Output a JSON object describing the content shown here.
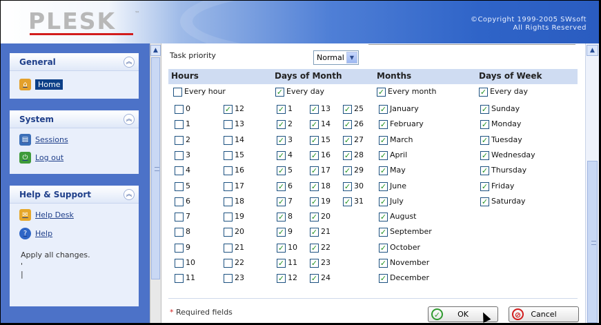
{
  "header": {
    "logo": "PLESK",
    "logo_tm": "™",
    "copyright_line1": "©Copyright 1999-2005 SWsoft",
    "copyright_line2": "All Rights Reserved"
  },
  "nav": {
    "general": {
      "title": "General",
      "items": [
        {
          "label": "Home"
        }
      ]
    },
    "system": {
      "title": "System",
      "items": [
        {
          "label": "Sessions"
        },
        {
          "label": "Log out"
        }
      ]
    },
    "help": {
      "title": "Help & Support",
      "items": [
        {
          "label": "Help Desk"
        },
        {
          "label": "Help"
        }
      ]
    },
    "status": "Apply all changes.",
    "status_marks": [
      "'",
      "|"
    ]
  },
  "form": {
    "task_priority_label": "Task priority",
    "task_priority_value": "Normal",
    "columns": {
      "hours": "Hours",
      "dom": "Days of Month",
      "months": "Months",
      "dow": "Days of Week"
    },
    "every": {
      "hour": "Every hour",
      "day": "Every day",
      "month": "Every month",
      "dow_day": "Every day"
    },
    "every_checked": {
      "hour": false,
      "day": true,
      "month": true,
      "dow_day": true
    },
    "hours": [
      {
        "label": "0",
        "checked": false
      },
      {
        "label": "1",
        "checked": false
      },
      {
        "label": "2",
        "checked": false
      },
      {
        "label": "3",
        "checked": false
      },
      {
        "label": "4",
        "checked": false
      },
      {
        "label": "5",
        "checked": false
      },
      {
        "label": "6",
        "checked": false
      },
      {
        "label": "7",
        "checked": false
      },
      {
        "label": "8",
        "checked": false
      },
      {
        "label": "9",
        "checked": false
      },
      {
        "label": "10",
        "checked": false
      },
      {
        "label": "11",
        "checked": false
      },
      {
        "label": "12",
        "checked": true
      },
      {
        "label": "13",
        "checked": false
      },
      {
        "label": "14",
        "checked": false
      },
      {
        "label": "15",
        "checked": false
      },
      {
        "label": "16",
        "checked": false
      },
      {
        "label": "17",
        "checked": false
      },
      {
        "label": "18",
        "checked": false
      },
      {
        "label": "19",
        "checked": false
      },
      {
        "label": "20",
        "checked": false
      },
      {
        "label": "21",
        "checked": false
      },
      {
        "label": "22",
        "checked": false
      },
      {
        "label": "23",
        "checked": false
      }
    ],
    "days": [
      "1",
      "2",
      "3",
      "4",
      "5",
      "6",
      "7",
      "8",
      "9",
      "10",
      "11",
      "12",
      "13",
      "14",
      "15",
      "16",
      "17",
      "18",
      "19",
      "20",
      "21",
      "22",
      "23",
      "24",
      "25",
      "26",
      "27",
      "28",
      "29",
      "30",
      "31"
    ],
    "months": [
      "January",
      "February",
      "March",
      "April",
      "May",
      "June",
      "July",
      "August",
      "September",
      "October",
      "November",
      "December"
    ],
    "weekdays": [
      "Sunday",
      "Monday",
      "Tuesday",
      "Wednesday",
      "Thursday",
      "Friday",
      "Saturday"
    ],
    "required_star": "*",
    "required_text": " Required fields",
    "ok_label": "OK",
    "cancel_label": "Cancel"
  },
  "colors": {
    "nav_bg": "#4c72c8",
    "header_blue": "#2f64c8",
    "check_green": "#219221",
    "required_red": "#d21c1c"
  }
}
